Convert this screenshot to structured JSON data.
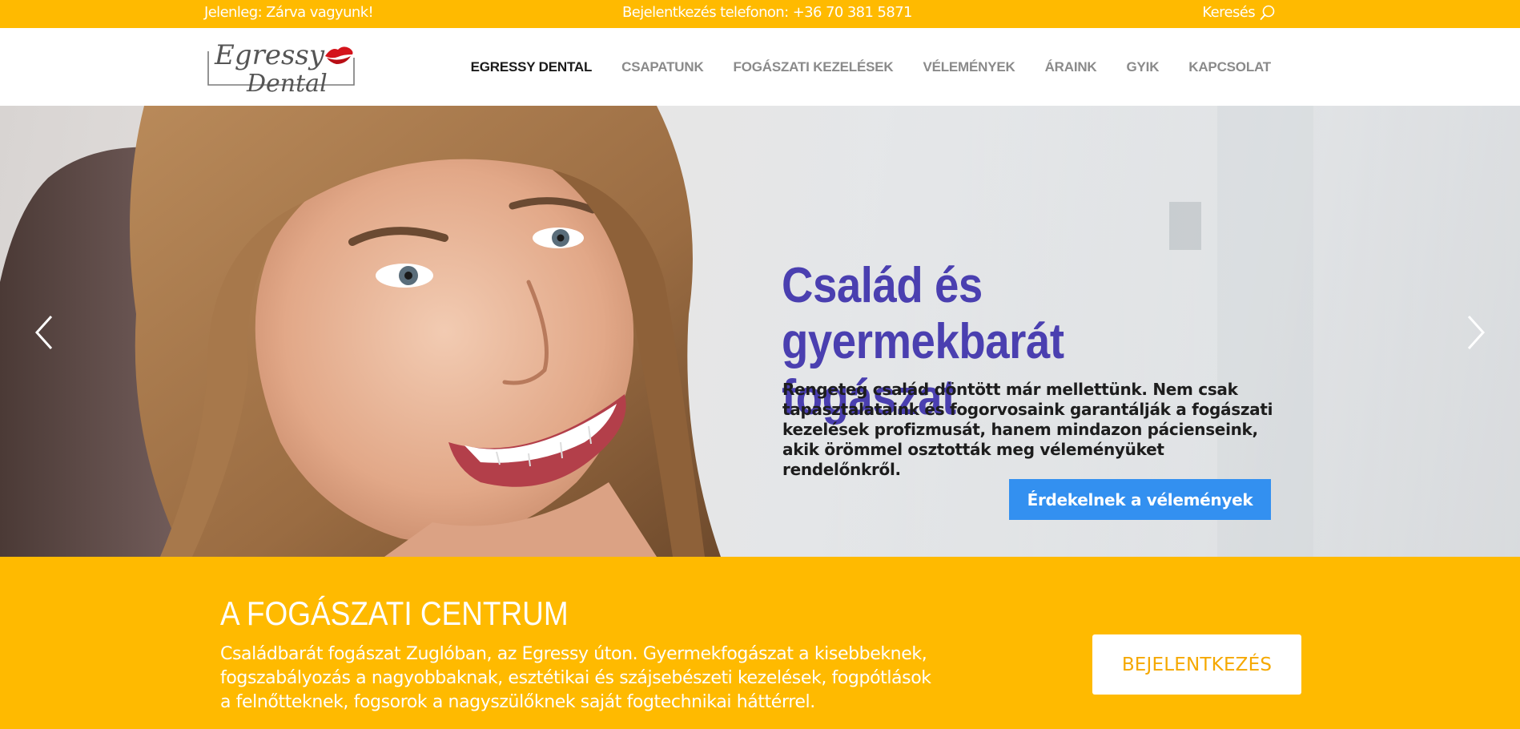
{
  "topbar": {
    "status": "Jelenleg: Zárva vagyunk!",
    "phone": "Bejelentkezés telefonon: +36 70 381 5871",
    "search_label": "Keresés"
  },
  "logo": {
    "line1": "Egressy",
    "line2": "Dental"
  },
  "nav": {
    "items": [
      {
        "label": "EGRESSY DENTAL",
        "active": true
      },
      {
        "label": "CSAPATUNK",
        "active": false
      },
      {
        "label": "FOGÁSZATI KEZELÉSEK",
        "active": false
      },
      {
        "label": "VÉLEMÉNYEK",
        "active": false
      },
      {
        "label": "ÁRAINK",
        "active": false
      },
      {
        "label": "GYIK",
        "active": false
      },
      {
        "label": "KAPCSOLAT",
        "active": false
      }
    ]
  },
  "hero": {
    "title": "Család és gyermekbarát fogászat",
    "description": "Rengeteg család döntött már mellettünk. Nem csak tapasztalataink és fogorvosaink garantálják a fogászati kezelések profizmusát, hanem mindazon pácienseink, akik örömmel osztották meg véleményüket rendelőnkről.",
    "cta_label": "Érdekelnek a vélemények"
  },
  "band": {
    "heading": "A FOGÁSZATI CENTRUM",
    "text": "Családbarát fogászat Zuglóban, az Egressy úton. Gyermekfogászat a kisebbeknek, fogszabályozás a nagyobbaknak, esztétikai és szájsebészeti kezelések, fogpótlások a felnőtteknek, fogsorok a nagyszülőknek saját fogtechnikai háttérrel.",
    "button_label": "BEJELENTKEZÉS"
  },
  "colors": {
    "accent_yellow": "#ffba00",
    "title_purple": "#4a3fb0",
    "cta_blue": "#3390f0"
  }
}
